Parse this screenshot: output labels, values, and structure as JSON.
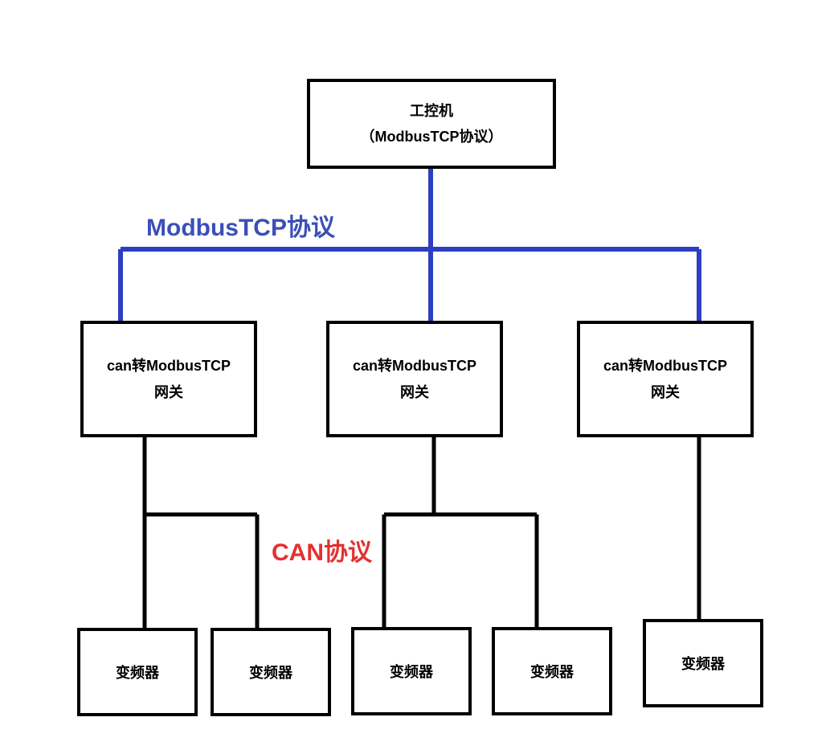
{
  "top": {
    "line1": "工控机",
    "line2": "（ModbusTCP协议）"
  },
  "labels": {
    "tcp": "ModbusTCP协议",
    "can": "CAN协议"
  },
  "gateways": {
    "line1": "can转ModbusTCP",
    "line2": "网关"
  },
  "inverter": "变频器",
  "colors": {
    "tcp_line": "#2b3fc0",
    "can_line": "#000000",
    "tcp_text": "#3b4fb8",
    "can_text": "#e53030"
  }
}
